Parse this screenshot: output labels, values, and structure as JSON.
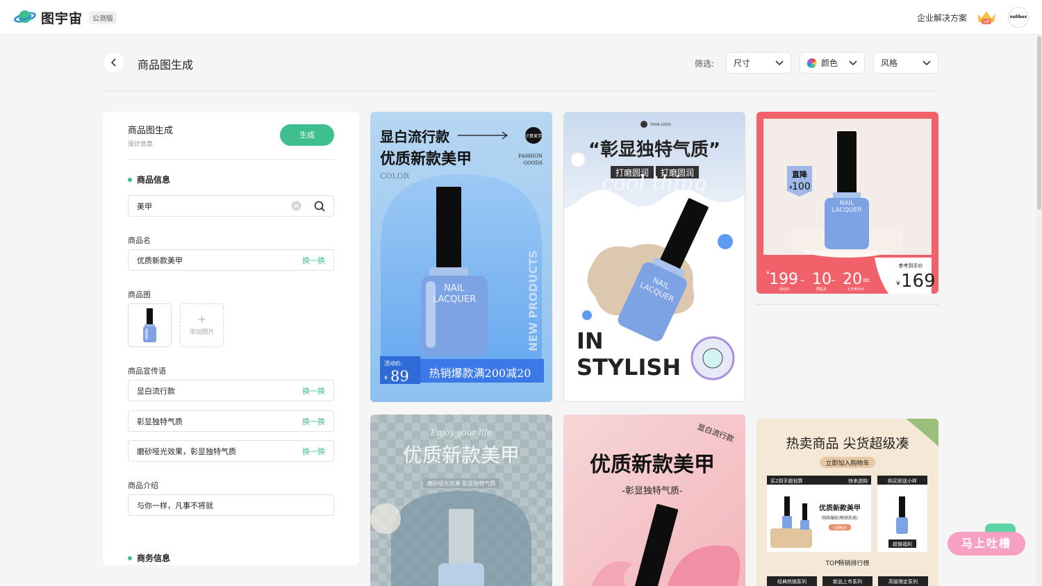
{
  "app": {
    "logo_text": "图宇宙",
    "beta_badge": "公测版",
    "enterprise_link": "企业解决方案",
    "vip_label": "VIP",
    "avatar_text": "nolibox"
  },
  "header": {
    "title": "商品图生成",
    "filter_label": "筛选:",
    "filters": [
      "尺寸",
      "颜色",
      "风格"
    ]
  },
  "panel": {
    "title": "商品图生成",
    "subtitle": "设计信息",
    "generate_label": "生成",
    "product_info_heading": "商品信息",
    "search_value": "美甲",
    "name_label": "商品名",
    "name_value": "优质新款美甲",
    "swap_label": "换一换",
    "image_label": "商品图",
    "add_image_label": "添加图片",
    "slogan_label": "商品宣传语",
    "slogans": [
      "显白流行款",
      "彰显独特气质",
      "磨砂哑光效果，彰显独特气质"
    ],
    "intro_label": "商品介绍",
    "intro_value": "与你一样，凡事不将就",
    "business_heading": "商务信息"
  },
  "cards": {
    "c1": {
      "title1": "显白流行款",
      "title2": "优质新款美甲",
      "color_word": "COLOR",
      "badge": "计算美学",
      "fashion1": "FASHION",
      "fashion2": "GOODS",
      "side_text": "NEW PRODUCTS",
      "bottle1": "NAIL",
      "bottle2": "LACQUER",
      "price_label": "活动价:",
      "currency": "¥",
      "price": "89",
      "promo": "热销爆款满200减20"
    },
    "c2": {
      "logo": "YOUR LOGO",
      "title": "“彰显独特气质”",
      "tag1": "打磨圆润",
      "tag2": "打磨圆润",
      "bg_word": "cool thing",
      "big1": "IN",
      "big2": "STYLISH",
      "bottle1": "NAIL",
      "bottle2": "LACQUER"
    },
    "c3": {
      "drop1": "直降",
      "drop_cur": "¥",
      "drop_amount": "100",
      "bottle1": "NAIL",
      "bottle2": "LACQUER",
      "p1": "199",
      "p2": "10",
      "p3": "20",
      "cur": "¥",
      "sub1": "活动价",
      "sub2": "预售减",
      "sub3": "七天到手价",
      "ref_label": "参考到手价",
      "final": "169"
    },
    "c4": {
      "script": "Enjoy your life",
      "title": "优质新款美甲",
      "pill": "磨砂哑光效果 彰显独特气质"
    },
    "c5": {
      "corner": "显白流行款",
      "title": "优质新款美甲",
      "subtitle": "-彰显独特气质-"
    },
    "c6": {
      "title": "热卖商品 尖货超级凑",
      "pill": "立即加入购物车",
      "box1_head_l": "买2到手超划算",
      "box1_head_r": "快来选购",
      "box2_head": "购买即送小样",
      "prod_name": "优质新款美甲",
      "prod_sub": "网络爆款/畅销热卖/",
      "buy_btn": "立即购买",
      "gift": "超值福利",
      "rank": "TOP畅销排行榜",
      "tabs": [
        "经典热销系列",
        "新品上市系列",
        "高级限定系列"
      ]
    }
  },
  "floating": {
    "feedback_label": "马上吐槽"
  }
}
